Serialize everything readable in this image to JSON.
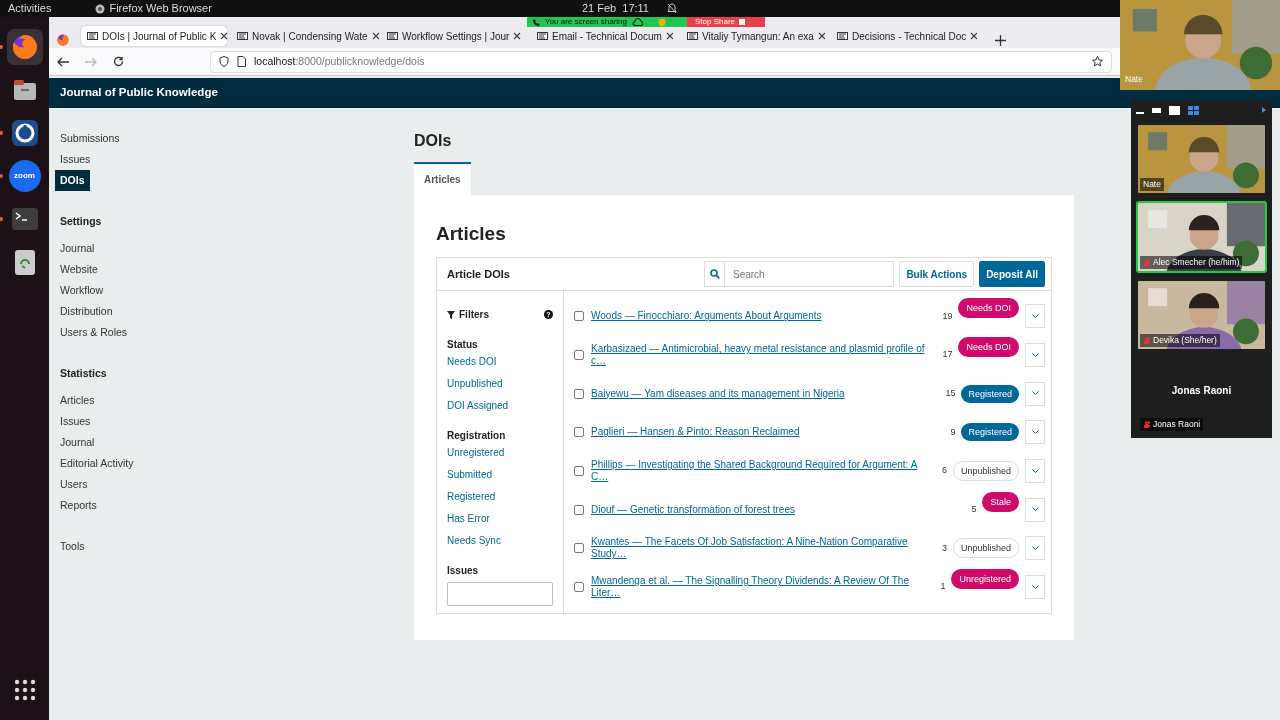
{
  "os_bar": {
    "activities": "Activities",
    "app_name": "Firefox Web Browser",
    "clock": "21 Feb  17:11"
  },
  "dock": [
    {
      "kind": "browser",
      "running": true,
      "selected": true
    },
    {
      "kind": "files",
      "running": false,
      "selected": false
    },
    {
      "kind": "timer",
      "running": true,
      "selected": false
    },
    {
      "kind": "zoom",
      "label": "zoom",
      "running": true,
      "selected": false
    },
    {
      "kind": "terminal",
      "running": true,
      "selected": false
    },
    {
      "kind": "trash",
      "running": false,
      "selected": false
    },
    {
      "kind": "apps",
      "running": false,
      "selected": false
    }
  ],
  "browser": {
    "tabs": [
      {
        "label": "DOIs | Journal of Public K",
        "selected": true
      },
      {
        "label": "Novak | Condensing Wate",
        "selected": false
      },
      {
        "label": "Workflow Settings | Jour",
        "selected": false
      },
      {
        "label": "Email - Technical Docum",
        "selected": false
      },
      {
        "label": "Vitaliy Tymangun: An exa",
        "selected": false
      },
      {
        "label": "Decisions - Technical Doc",
        "selected": false
      }
    ],
    "url": {
      "host": "localhost",
      "path": ":8000/publicknowledge/dois"
    }
  },
  "share_bar": {
    "text": "You are screen sharing",
    "stop": "Stop Share"
  },
  "app": {
    "title": "Journal of Public Knowledge"
  },
  "sidebar": [
    {
      "items": [
        {
          "label": "Submissions",
          "selected": false
        },
        {
          "label": "Issues",
          "selected": false
        },
        {
          "label": "DOIs",
          "selected": true
        }
      ]
    },
    {
      "heading": "Settings",
      "items": [
        {
          "label": "Journal",
          "selected": false
        },
        {
          "label": "Website",
          "selected": false
        },
        {
          "label": "Workflow",
          "selected": false
        },
        {
          "label": "Distribution",
          "selected": false
        },
        {
          "label": "Users & Roles",
          "selected": false
        }
      ]
    },
    {
      "heading": "Statistics",
      "items": [
        {
          "label": "Articles",
          "selected": false
        },
        {
          "label": "Issues",
          "selected": false
        },
        {
          "label": "Journal",
          "selected": false
        },
        {
          "label": "Editorial Activity",
          "selected": false
        },
        {
          "label": "Users",
          "selected": false
        },
        {
          "label": "Reports",
          "selected": false
        }
      ]
    },
    {
      "items": [
        {
          "label": "Tools",
          "selected": false
        }
      ]
    }
  ],
  "page": {
    "title": "DOIs",
    "tabs": [
      {
        "label": "Articles",
        "selected": true
      }
    ],
    "heading": "Articles"
  },
  "table": {
    "title": "Article DOIs",
    "search": {
      "placeholder": "Search"
    },
    "buttons": [
      {
        "label": "Bulk Actions",
        "kind": "outline"
      },
      {
        "label": "Deposit All",
        "kind": "primary"
      }
    ],
    "filters": {
      "title": "Filters",
      "help": "?",
      "groups": [
        {
          "heading": "Status",
          "options": [
            "Needs DOI",
            "Unpublished",
            "DOI Assigned"
          ]
        },
        {
          "heading": "Registration",
          "options": [
            "Unregistered",
            "Submitted",
            "Registered",
            "Has Error",
            "Needs Sync"
          ]
        }
      ],
      "issues_label": "Issues"
    },
    "rows": [
      {
        "title": "Woods — Finocchiaro: Arguments About Arguments",
        "count": "19",
        "status": "Needs DOI",
        "kind": "alert",
        "checked": false
      },
      {
        "title": "Karbasizaed — Antimicrobial, heavy metal resistance and plasmid profile of c…",
        "count": "17",
        "status": "Needs DOI",
        "kind": "alert",
        "checked": false
      },
      {
        "title": "Baiyewu — Yam diseases and its management in Nigeria",
        "count": "15",
        "status": "Registered",
        "kind": "ok",
        "checked": false
      },
      {
        "title": "Paglieri — Hansen & Pinto: Reason Reclaimed",
        "count": "9",
        "status": "Registered",
        "kind": "ok",
        "checked": false
      },
      {
        "title": "Phillips — Investigating the Shared Background Required for Argument: A C…",
        "count": "6",
        "status": "Unpublished",
        "kind": "neutral",
        "checked": false
      },
      {
        "title": "Diouf — Genetic transformation of forest trees",
        "count": "5",
        "status": "Stale",
        "kind": "alert",
        "checked": false
      },
      {
        "title": "Kwantes — The Facets Of Job Satisfaction: A Nine-Nation Comparative Study…",
        "count": "3",
        "status": "Unpublished",
        "kind": "neutral",
        "checked": false
      },
      {
        "title": "Mwandenga et al. — The Signalling Theory Dividends: A Review Of The Liter…",
        "count": "1",
        "status": "Unregistered",
        "kind": "alert",
        "checked": false
      }
    ]
  },
  "meeting": {
    "main": {
      "name": "Nate",
      "kind": "picture"
    },
    "tiles": [
      {
        "name": "Nate",
        "kind": "picture",
        "muted": false,
        "speaking": false
      },
      {
        "name": "Alec Smecher (he/him)",
        "kind": "picture",
        "muted": true,
        "speaking": true
      },
      {
        "name": "Devika (She/her)",
        "kind": "picture",
        "muted": true,
        "speaking": false
      },
      {
        "name": "Jonas Raoni",
        "display": "Jonas Raoni",
        "kind": "avatar",
        "muted": true,
        "speaking": false
      }
    ]
  }
}
